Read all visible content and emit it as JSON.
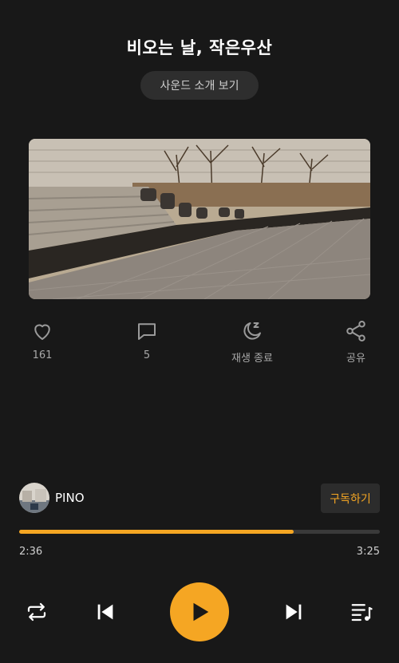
{
  "track": {
    "title": "비오는 날, 작은우산"
  },
  "intro_button": {
    "label": "사운드 소개 보기"
  },
  "actions": [
    {
      "icon": "heart-icon",
      "label": "161"
    },
    {
      "icon": "comment-icon",
      "label": "5"
    },
    {
      "icon": "sleep-timer-icon",
      "label": "재생 종료"
    },
    {
      "icon": "share-icon",
      "label": "공유"
    }
  ],
  "creator": {
    "name": "PINO",
    "subscribe_label": "구독하기"
  },
  "player": {
    "current_time": "2:36",
    "total_time": "3:25",
    "progress": 0.76
  },
  "controls": [
    "repeat-icon",
    "previous-icon",
    "play-icon",
    "next-icon",
    "playlist-icon"
  ],
  "colors": {
    "accent": "#F5A623",
    "background": "#181818"
  }
}
